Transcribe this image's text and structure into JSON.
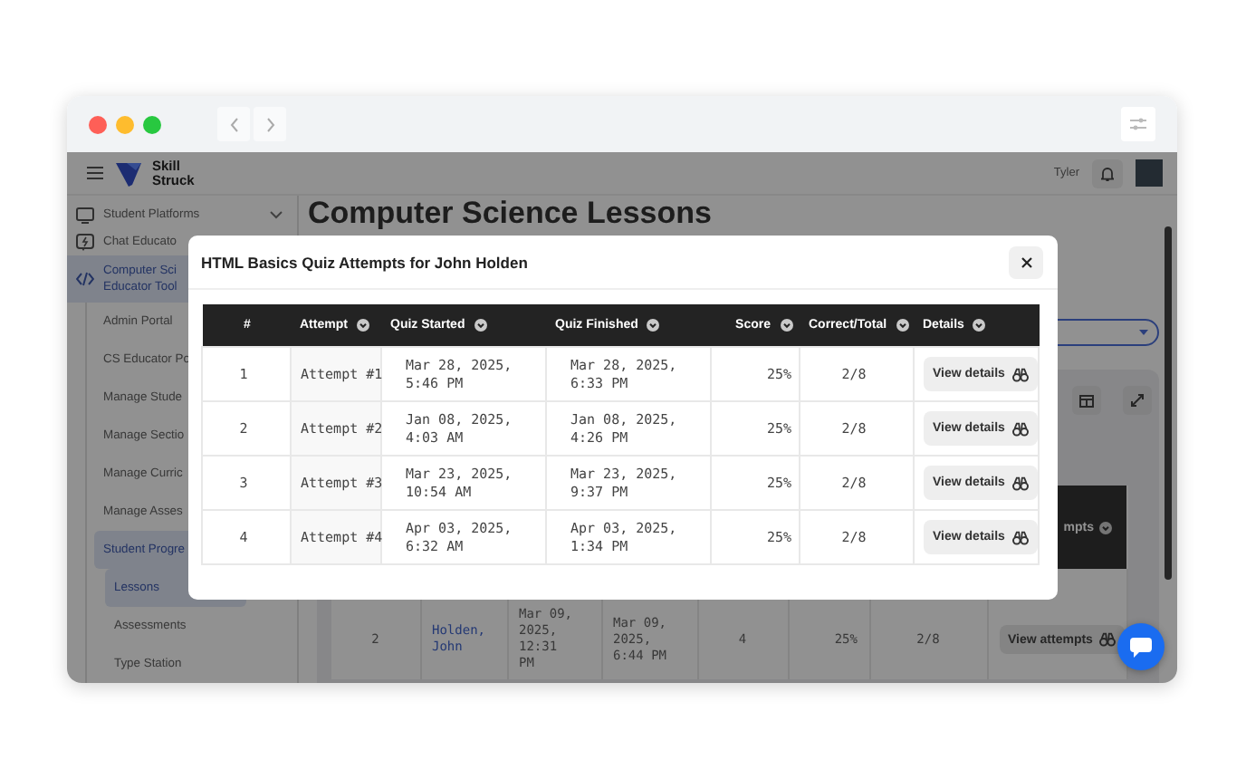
{
  "app_header": {
    "brand_lines": [
      "Skill",
      "Struck"
    ],
    "user_name": "Tyler"
  },
  "sidebar": {
    "items": [
      {
        "label_lines": [
          "Student Platforms"
        ],
        "selected": false,
        "expanded": false
      },
      {
        "label_lines": [
          "Chat Educato"
        ],
        "selected": false
      },
      {
        "label_lines": [
          "Computer Sci",
          "Educator Tool"
        ],
        "selected": true,
        "children": [
          {
            "label": "Admin Portal",
            "selected": false
          },
          {
            "label": "CS Educator Po",
            "selected": false
          },
          {
            "label": "Manage Stude",
            "selected": false
          },
          {
            "label": "Manage Sectio",
            "selected": false
          },
          {
            "label": "Manage Curric",
            "selected": false
          },
          {
            "label": "Manage Asses",
            "selected": false
          },
          {
            "label": "Student Progre",
            "selected": true,
            "children": [
              {
                "label": "Lessons",
                "selected": true
              },
              {
                "label": "Assessments",
                "selected": false
              },
              {
                "label": "Type Station",
                "selected": false
              }
            ]
          }
        ]
      }
    ]
  },
  "page_title": "Computer Science Lessons",
  "lessons_table": {
    "last_column_header": "mpts",
    "rows": [
      {
        "cells": [
          "2",
          "Holden, John",
          "Mar 09, 2025, 12:31 PM",
          "Mar 09, 2025, 6:44 PM",
          "4",
          "25%",
          "2/8"
        ],
        "action": "View attempts"
      }
    ]
  },
  "modal": {
    "title": "HTML Basics Quiz Attempts for John Holden",
    "columns": [
      {
        "label": "#",
        "filter": false
      },
      {
        "label": "Attempt",
        "filter": true
      },
      {
        "label": "Quiz Started",
        "filter": true
      },
      {
        "label": "Quiz Finished",
        "filter": true
      },
      {
        "label": "Score",
        "filter": true
      },
      {
        "label": "Correct/Total",
        "filter": true
      },
      {
        "label": "Details",
        "filter": true
      }
    ],
    "rows": [
      {
        "cells": [
          "1",
          "Attempt #1",
          "Mar 28, 2025, 5:46 PM",
          "Mar 28, 2025, 6:33 PM",
          "25%",
          "2/8"
        ],
        "action": "View details"
      },
      {
        "cells": [
          "2",
          "Attempt #2",
          "Jan 08, 2025, 4:03 AM",
          "Jan 08, 2025, 4:26 PM",
          "25%",
          "2/8"
        ],
        "action": "View details"
      },
      {
        "cells": [
          "3",
          "Attempt #3",
          "Mar 23, 2025, 10:54 AM",
          "Mar 23, 2025, 9:37 PM",
          "25%",
          "2/8"
        ],
        "action": "View details"
      },
      {
        "cells": [
          "4",
          "Attempt #4",
          "Apr 03, 2025, 6:32 AM",
          "Apr 03, 2025, 1:34 PM",
          "25%",
          "2/8"
        ],
        "action": "View details"
      }
    ]
  }
}
